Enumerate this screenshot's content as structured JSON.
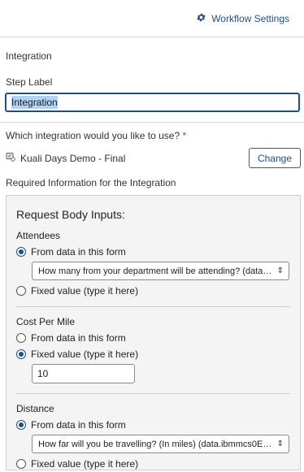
{
  "header": {
    "workflow_settings_label": "Workflow Settings"
  },
  "section_title": "Integration",
  "step_label": {
    "label": "Step Label",
    "value": "Integration"
  },
  "integration": {
    "question": "Which integration would you like to use?",
    "required_mark": "*",
    "selected": "Kuali Days Demo - Final",
    "change_label": "Change"
  },
  "required_info_label": "Required Information for the Integration",
  "panel": {
    "title": "Request Body Inputs:",
    "groups": [
      {
        "label": "Attendees",
        "option_form": "From data in this form",
        "option_fixed": "Fixed value (type it here)",
        "selected": "form",
        "select_value": "How many from your department will be attending? (data.y..."
      },
      {
        "label": "Cost Per Mile",
        "option_form": "From data in this form",
        "option_fixed": "Fixed value (type it here)",
        "selected": "fixed",
        "fixed_value": "10"
      },
      {
        "label": "Distance",
        "option_form": "From data in this form",
        "option_fixed": "Fixed value (type it here)",
        "selected": "form",
        "select_value": "How far will you be travelling? (In miles) (data.ibmmcs0Ebo)"
      }
    ]
  },
  "colors": {
    "accent": "#1f4e8f",
    "required": "#c0392b",
    "panel_bg": "#f4f4f4"
  },
  "icons": {
    "settings": "gear-icon",
    "integration": "integration-icon",
    "select_arrow": "select-arrows-icon"
  }
}
